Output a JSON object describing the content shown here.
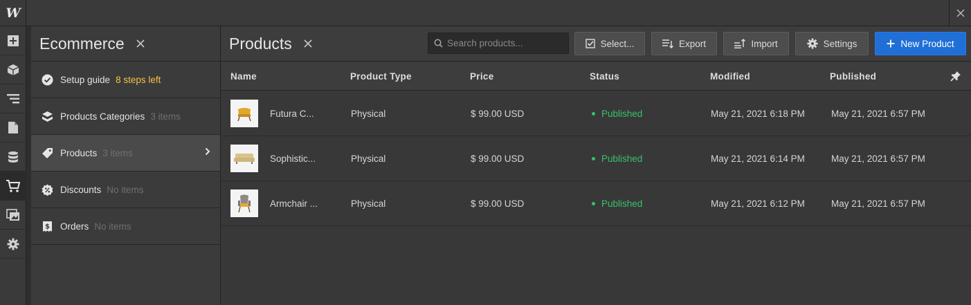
{
  "app": {
    "logo_letter": "W"
  },
  "rail": {
    "items": [
      {
        "icon": "add-icon"
      },
      {
        "icon": "cube-icon"
      },
      {
        "icon": "navigator-icon"
      },
      {
        "icon": "pages-icon"
      },
      {
        "icon": "database-icon"
      },
      {
        "icon": "cart-icon",
        "active": true
      },
      {
        "icon": "assets-icon"
      },
      {
        "icon": "gear-icon"
      }
    ]
  },
  "panel": {
    "title": "Ecommerce",
    "items": [
      {
        "label": "Setup guide",
        "sub": "8 steps left",
        "icon": "check-circle-icon"
      },
      {
        "label": "Products Categories",
        "sub": "3 items",
        "icon": "categories-icon"
      },
      {
        "label": "Products",
        "sub": "3 items",
        "icon": "tag-icon",
        "selected": true
      },
      {
        "label": "Discounts",
        "sub": "No items",
        "icon": "discount-icon"
      },
      {
        "label": "Orders",
        "sub": "No items",
        "icon": "order-icon"
      }
    ]
  },
  "main": {
    "title": "Products",
    "search_placeholder": "Search products...",
    "buttons": {
      "select": "Select...",
      "export": "Export",
      "import": "Import",
      "settings": "Settings",
      "new_product": "New Product"
    },
    "columns": [
      "Name",
      "Product Type",
      "Price",
      "Status",
      "Modified",
      "Published"
    ],
    "rows": [
      {
        "name": "Futura C...",
        "type": "Physical",
        "price": "$ 99.00 USD",
        "status": "Published",
        "modified": "May 21, 2021 6:18 PM",
        "published": "May 21, 2021 6:57 PM",
        "thumb": "chair-thumbnail"
      },
      {
        "name": "Sophistic...",
        "type": "Physical",
        "price": "$ 99.00 USD",
        "status": "Published",
        "modified": "May 21, 2021 6:14 PM",
        "published": "May 21, 2021 6:57 PM",
        "thumb": "sofa-thumbnail"
      },
      {
        "name": "Armchair ...",
        "type": "Physical",
        "price": "$ 99.00 USD",
        "status": "Published",
        "modified": "May 21, 2021 6:12 PM",
        "published": "May 21, 2021 6:57 PM",
        "thumb": "armchair-thumbnail"
      }
    ]
  },
  "colors": {
    "accent": "#1f6fd6",
    "published": "#37c26a",
    "warning": "#f5c344"
  }
}
